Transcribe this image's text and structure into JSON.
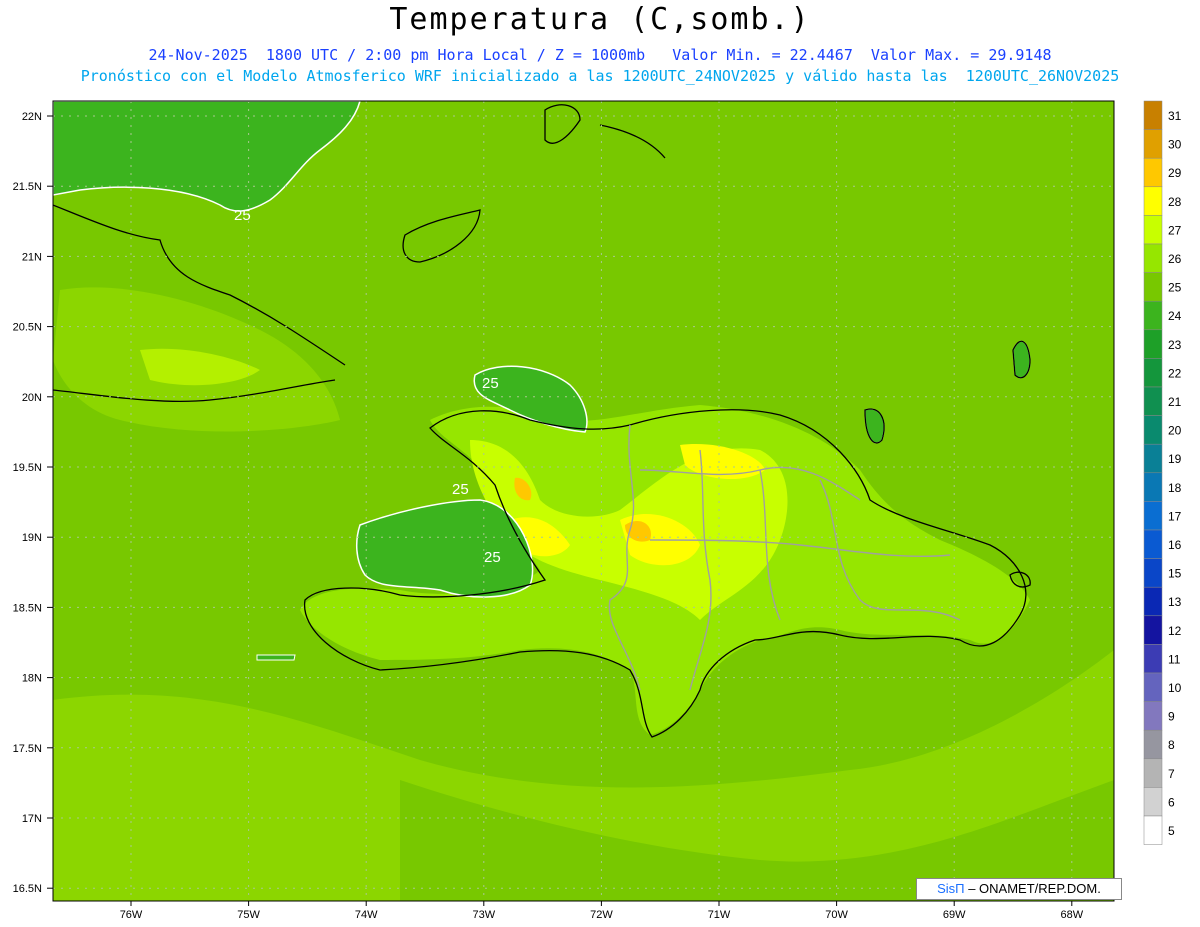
{
  "header": {
    "title": "Temperatura (C,somb.)",
    "line1": "24-Nov-2025  1800 UTC / 2:00 pm Hora Local / Z = 1000mb   Valor Min. = 22.4467  Valor Max. = 29.9148",
    "line2": "Pronóstico con el Modelo Atmosferico WRF inicializado a las 1200UTC_24NOV2025 y válido hasta las  1200UTC_26NOV2025"
  },
  "axes": {
    "lat_labels": [
      "22N",
      "21.5N",
      "21N",
      "20.5N",
      "20N",
      "19.5N",
      "19N",
      "18.5N",
      "18N",
      "17.5N",
      "17N",
      "16.5N"
    ],
    "lon_labels": [
      "76W",
      "75W",
      "74W",
      "73W",
      "72W",
      "71W",
      "70W",
      "69W",
      "68W"
    ]
  },
  "contour_labels": [
    "25",
    "25",
    "25",
    "25"
  ],
  "colorbar": {
    "levels": [
      "31",
      "30",
      "29",
      "28",
      "27",
      "26",
      "25",
      "24",
      "23",
      "22",
      "21",
      "20",
      "19",
      "18",
      "17",
      "16",
      "15",
      "13",
      "12",
      "11",
      "10",
      "9",
      "8",
      "7",
      "6",
      "5"
    ],
    "colors": [
      "#c88000",
      "#e0a000",
      "#ffc800",
      "#ffff00",
      "#c8ff00",
      "#96e600",
      "#78c800",
      "#3cb41e",
      "#1ea028",
      "#14963c",
      "#109050",
      "#0a8a6e",
      "#0a8096",
      "#0a78b4",
      "#0a6ed2",
      "#0a5ad2",
      "#0a46c8",
      "#0a28b4",
      "#1414a0",
      "#3c3cb4",
      "#6464be",
      "#8278be",
      "#9696a0",
      "#b4b4b4",
      "#d2d2d2",
      "#ffffff"
    ]
  },
  "credit": {
    "brand": "SisΠ",
    "org": " – ONAMET/REP.DOM."
  },
  "chart_data": {
    "type": "heatmap",
    "variable": "Temperatura (C,somb.)",
    "level": "1000mb",
    "valid_time": "24-Nov-2025 1800 UTC",
    "min_value": 22.4467,
    "max_value": 29.9148,
    "lon_range": [
      -76.6,
      -67.6
    ],
    "lat_range": [
      16.4,
      22.1
    ],
    "contour_value": 25,
    "colorbar_levels": [
      5,
      6,
      7,
      8,
      9,
      10,
      11,
      12,
      13,
      15,
      16,
      17,
      18,
      19,
      20,
      21,
      22,
      23,
      24,
      25,
      26,
      27,
      28,
      29,
      30,
      31
    ]
  }
}
